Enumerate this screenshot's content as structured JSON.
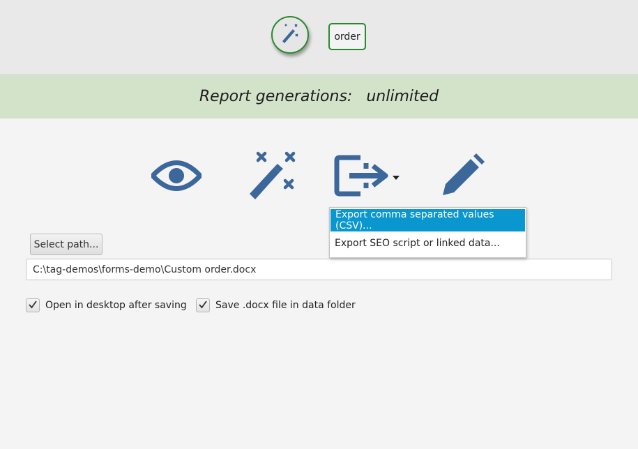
{
  "header": {
    "wand_icon": "magic-wand-icon",
    "order_label": "order"
  },
  "banner": {
    "label": "Report generations:",
    "value": "unlimited"
  },
  "toolbar": {
    "icons": [
      "eye-icon",
      "magic-wand-icon",
      "export-icon",
      "pencil-icon"
    ],
    "icon_color": "#3c679b"
  },
  "export_menu": {
    "items": [
      "Export comma separated values (CSV)...",
      "Export SEO script or linked data..."
    ],
    "highlight_color": "#0a96cf"
  },
  "path_section": {
    "select_label": "Select path...",
    "path_value": "C:\\tag-demos\\forms-demo\\Custom order.docx"
  },
  "options": {
    "open_desktop_label": "Open in desktop after saving",
    "open_desktop_checked": true,
    "save_docx_label": "Save .docx file in data folder",
    "save_docx_checked": true
  },
  "colors": {
    "accent_green": "#2a8a2a",
    "banner_bg": "#d3e3c9"
  }
}
